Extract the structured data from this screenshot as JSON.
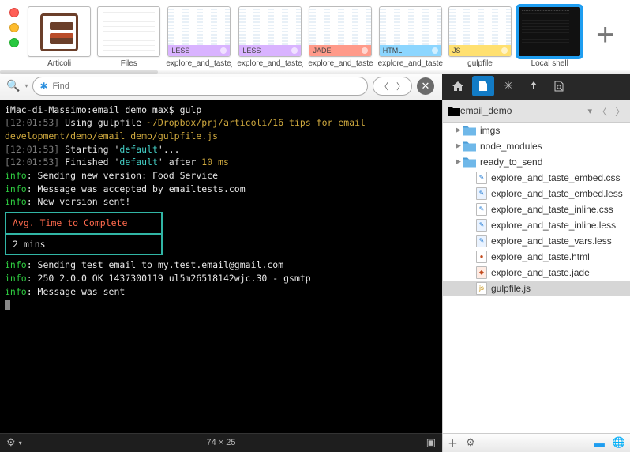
{
  "tabs": [
    {
      "label": "Articoli"
    },
    {
      "label": "Files"
    },
    {
      "label": "explore_and_taste_vars",
      "lang": "LESS"
    },
    {
      "label": "explore_and_taste_embed",
      "lang": "LESS"
    },
    {
      "label": "explore_and_taste",
      "lang": "JADE"
    },
    {
      "label": "explore_and_taste",
      "lang": "HTML"
    },
    {
      "label": "gulpfile",
      "lang": "JS"
    },
    {
      "label": "Local shell",
      "selected": true
    }
  ],
  "find": {
    "placeholder": "Find"
  },
  "terminal": {
    "prompt_pre": "iMac-di-Massimo:email_demo max$ ",
    "prompt_cmd": "gulp",
    "l1_ts": "[12:01:53]",
    "l1_a": " Using gulpfile ",
    "l1_b": "~/Dropbox/prj/articoli/16 tips for email development/demo/email_demo/gulpfile.js",
    "l2_ts": "[12:01:53]",
    "l2_a": " Starting '",
    "l2_b": "default",
    "l2_c": "'...",
    "l3_ts": "[12:01:53]",
    "l3_a": " Finished '",
    "l3_b": "default",
    "l3_c": "' after ",
    "l3_d": "10 ms",
    "info": "info",
    "i1": ": Sending new version: Food Service",
    "i2": ": Message was accepted by emailtests.com",
    "i3": ": New version sent!",
    "box_header": "Avg. Time to Complete",
    "box_value": "2 mins",
    "i4": ": Sending test email to my.test.email@gmail.com",
    "i5": ": 250 2.0.0 OK 1437300119 ul5m26518142wjc.30 - gsmtp",
    "i6": ": Message was sent",
    "statusbar": {
      "dims": "74 × 25"
    }
  },
  "sidebar": {
    "root": "email_demo",
    "dir_tri": "▾",
    "folders": [
      "imgs",
      "node_modules",
      "ready_to_send"
    ],
    "files": [
      {
        "name": "explore_and_taste_embed.css",
        "kind": "css"
      },
      {
        "name": "explore_and_taste_embed.less",
        "kind": "less"
      },
      {
        "name": "explore_and_taste_inline.css",
        "kind": "css"
      },
      {
        "name": "explore_and_taste_inline.less",
        "kind": "less"
      },
      {
        "name": "explore_and_taste_vars.less",
        "kind": "less"
      },
      {
        "name": "explore_and_taste.html",
        "kind": "html"
      },
      {
        "name": "explore_and_taste.jade",
        "kind": "jade"
      },
      {
        "name": "gulpfile.js",
        "kind": "js",
        "selected": true
      }
    ]
  }
}
